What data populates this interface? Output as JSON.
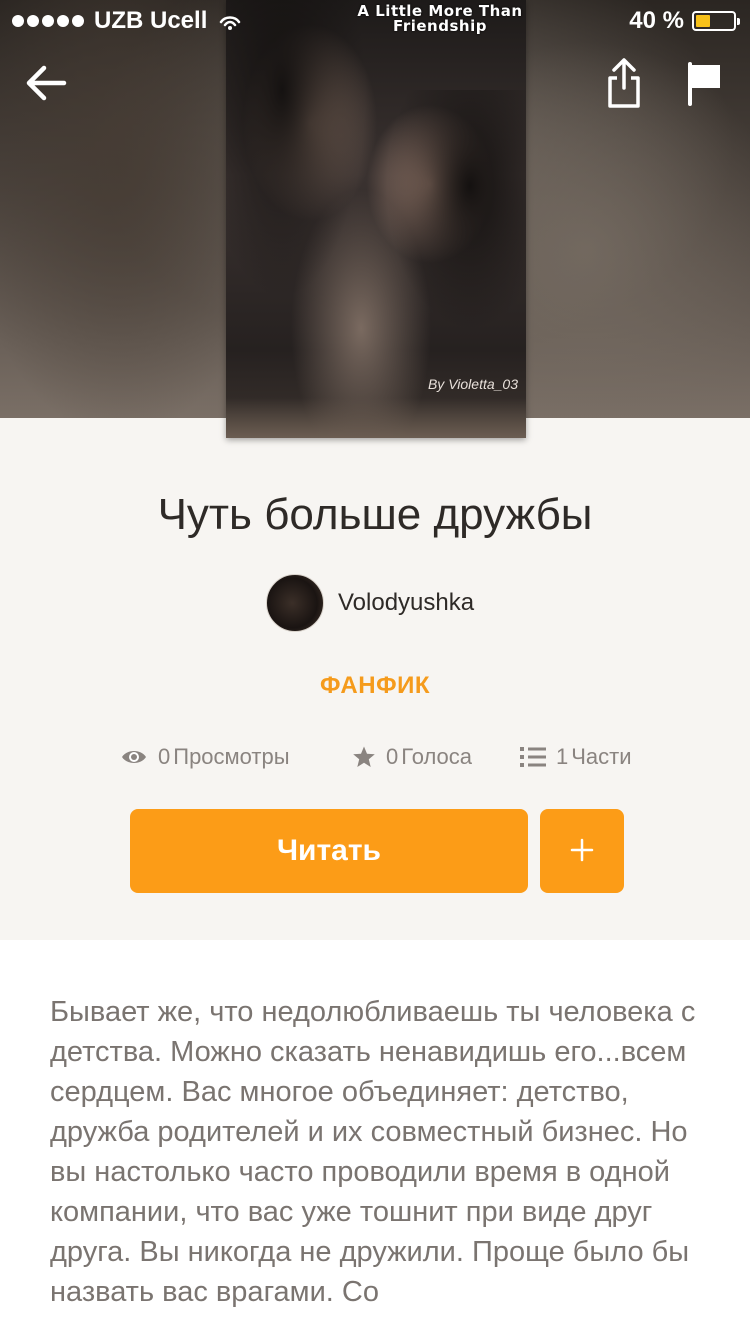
{
  "status_bar": {
    "carrier": "UZB Ucell",
    "battery_percent": "40 %",
    "battery_level": 0.4,
    "battery_color": "#f7c11a"
  },
  "header": {
    "back_icon": "arrow-left-icon",
    "share_icon": "share-icon",
    "report_icon": "flag-icon"
  },
  "cover": {
    "title_text": "A Little More Than Friendship",
    "credit": "By Violetta_03"
  },
  "story": {
    "title": "Чуть больше дружбы",
    "author": "Volodyushka",
    "category": "ФАНФИК",
    "stats": {
      "views_count": "0",
      "views_label": "Просмотры",
      "votes_count": "0",
      "votes_label": "Голоса",
      "parts_count": "1",
      "parts_label": "Части"
    },
    "read_button": "Читать",
    "add_button": "+",
    "description": "Бывает же, что недолюбливаешь ты человека с детства. Можно сказать ненавидишь его...всем сердцем. Вас многое объединяет: детство, дружба родителей и их совместный бизнес. Но вы настолько часто проводили время в одной компании, что вас уже тошнит при виде друг друга. Вы никогда не дружили. Проще было бы назвать вас врагами. Со"
  },
  "colors": {
    "accent": "#fc9c17",
    "category": "#f59b1c",
    "background": "#f7f5f2"
  }
}
